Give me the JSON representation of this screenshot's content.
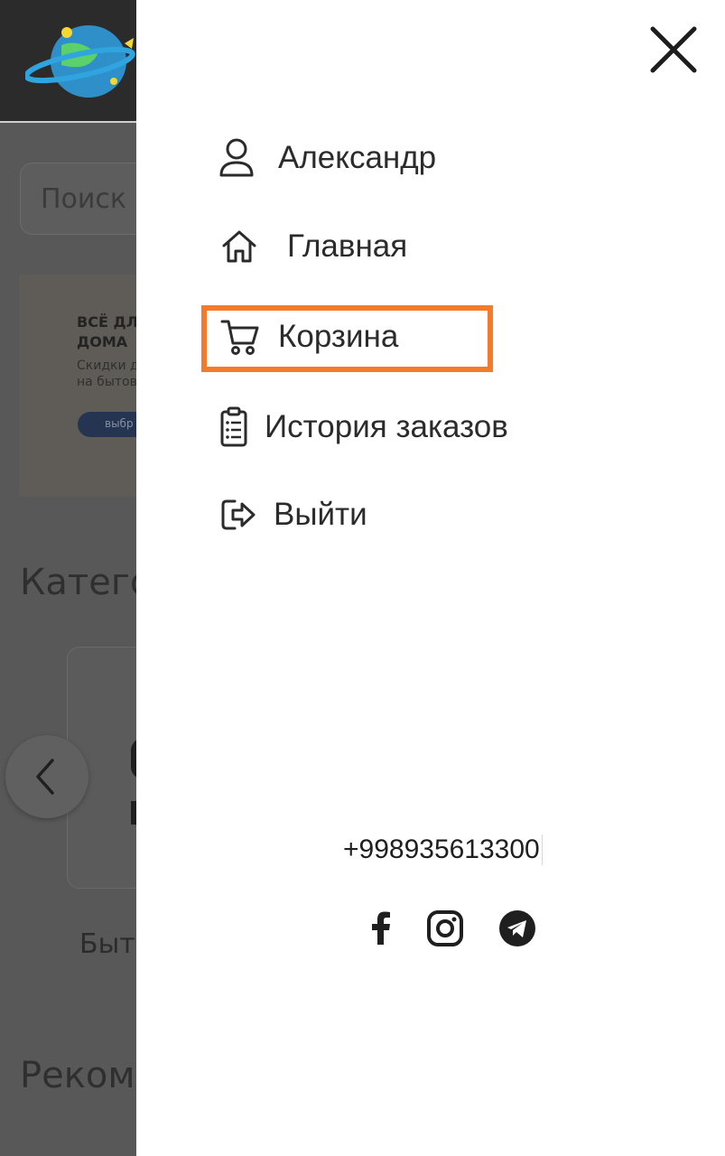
{
  "background_page": {
    "search_placeholder": "Поиск",
    "banner": {
      "title_line1": "ВСЁ ДЛ",
      "title_line2": "ДОМА",
      "subtitle_line1": "Скидки д",
      "subtitle_line2": "на бытову",
      "button_label": "выбр"
    },
    "categories_heading": "Катего",
    "category_label": "Быт",
    "recommended_heading": "Реком"
  },
  "drawer": {
    "menu": [
      {
        "label": "Александр",
        "icon": "user-icon"
      },
      {
        "label": "Главная",
        "icon": "home-icon"
      },
      {
        "label": "Корзина",
        "icon": "cart-icon",
        "highlighted": true
      },
      {
        "label": "История заказов",
        "icon": "clipboard-icon"
      },
      {
        "label": "Выйти",
        "icon": "logout-icon"
      }
    ],
    "phone": "+998935613300",
    "social": [
      "facebook-icon",
      "instagram-icon",
      "telegram-icon"
    ],
    "highlight_color": "#f47a2c"
  }
}
